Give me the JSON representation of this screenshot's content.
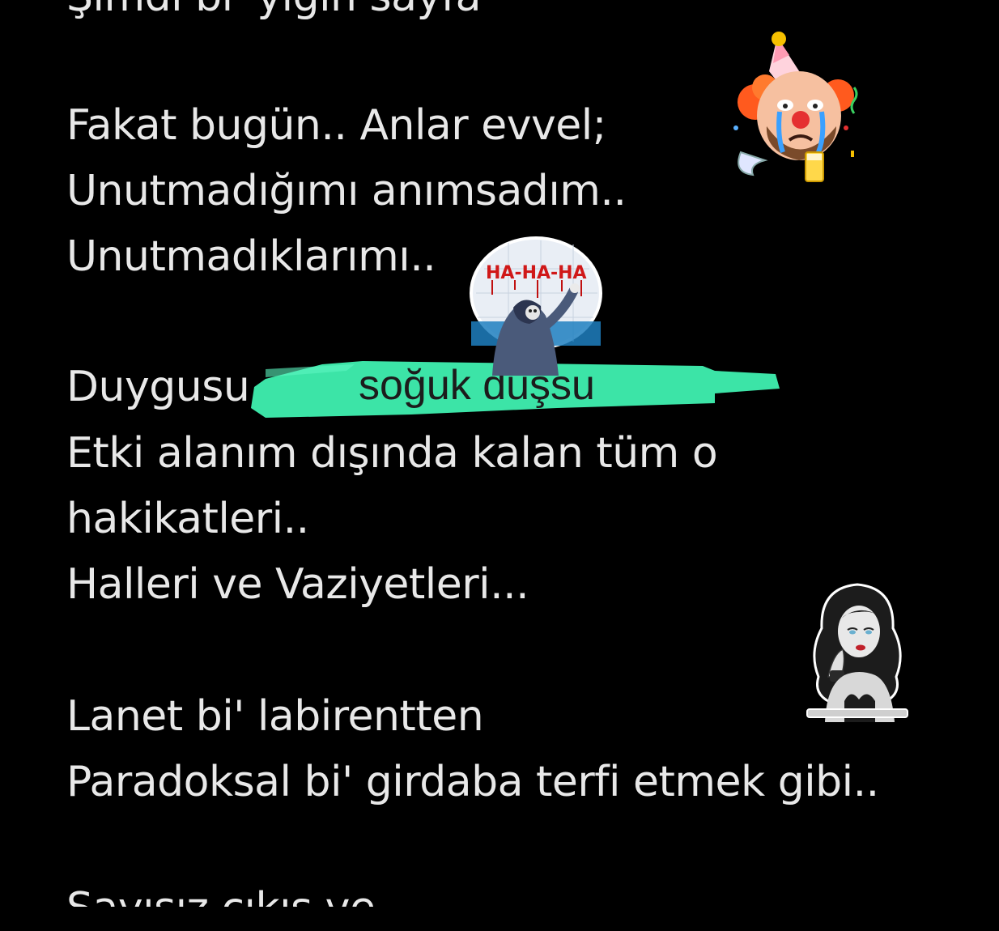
{
  "text_lines": {
    "cut_top": "Şimdi bi' yığın sayfa",
    "l1": "Fakat bugün.. Anlar evvel;",
    "l2": "Unutmadığımı anımsadım..",
    "l3": "Unutmadıklarımı..",
    "l4": "Duygusu",
    "l5": "Etki alanım dışında kalan tüm o",
    "l6": "hakikatleri..",
    "l7": "Halleri ve Vaziyetleri...",
    "l8": "Lanet bi' labirentten",
    "l9": "Paradoksal bi' girdaba terfi etmek gibi..",
    "cut_bottom": "Sayısız çıkış ve"
  },
  "highlight": {
    "text": "soğuk duşsu",
    "color": "#3ff0b0"
  },
  "stickers": {
    "clown": "party-clown-sticker",
    "reaper": "reaper-haha-sticker",
    "reaper_caption": "HA-HA-HA",
    "lady": "bored-lady-sticker"
  },
  "colors": {
    "background": "#000000",
    "text": "#e8e8e8"
  }
}
